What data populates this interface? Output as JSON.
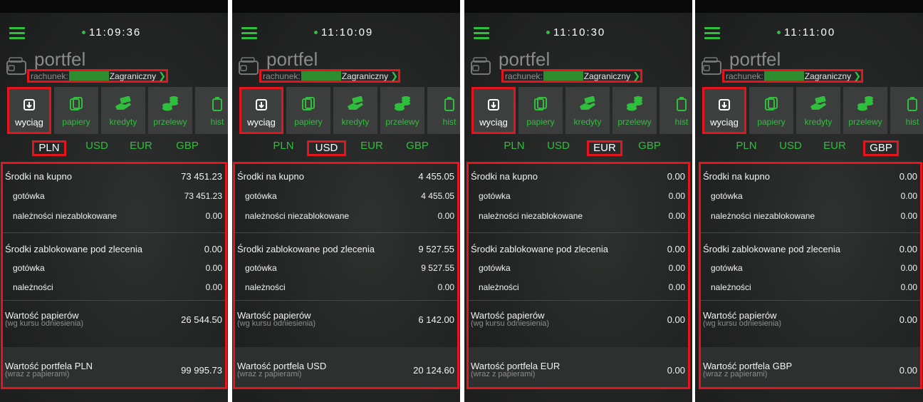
{
  "screens": [
    {
      "time": "11:09:36",
      "app_name": "portfel",
      "account_label": "rachunek:",
      "account_name": "Zagraniczny",
      "tiles": [
        "wyciąg",
        "papiery",
        "kredyty",
        "przelewy",
        "hist"
      ],
      "currencies": [
        "PLN",
        "USD",
        "EUR",
        "GBP"
      ],
      "active_currency": "PLN",
      "rows": {
        "buy_funds_label": "Środki na kupno",
        "buy_funds": "73 451.23",
        "cash_label": "gotówka",
        "cash": "73 451.23",
        "unblocked_label": "należności niezablokowane",
        "unblocked": "0.00",
        "blocked_label": "Środki zablokowane pod zlecenia",
        "blocked": "0.00",
        "blocked_cash_label": "gotówka",
        "blocked_cash": "0.00",
        "receivables_label": "należności",
        "receivables": "0.00",
        "securities_label": "Wartość papierów",
        "securities_note": "(wg kursu odniesienia)",
        "securities": "26 544.50",
        "portfolio_label": "Wartość portfela PLN",
        "portfolio_note": "(wraz z papierami)",
        "portfolio": "99 995.73"
      }
    },
    {
      "time": "11:10:09",
      "app_name": "portfel",
      "account_label": "rachunek:",
      "account_name": "Zagraniczny",
      "tiles": [
        "wyciąg",
        "papiery",
        "kredyty",
        "przelewy",
        "hist"
      ],
      "currencies": [
        "PLN",
        "USD",
        "EUR",
        "GBP"
      ],
      "active_currency": "USD",
      "rows": {
        "buy_funds_label": "Środki na kupno",
        "buy_funds": "4 455.05",
        "cash_label": "gotówka",
        "cash": "4 455.05",
        "unblocked_label": "należności niezablokowane",
        "unblocked": "0.00",
        "blocked_label": "Środki zablokowane pod zlecenia",
        "blocked": "9 527.55",
        "blocked_cash_label": "gotówka",
        "blocked_cash": "9 527.55",
        "receivables_label": "należności",
        "receivables": "0.00",
        "securities_label": "Wartość papierów",
        "securities_note": "(wg kursu odniesienia)",
        "securities": "6 142.00",
        "portfolio_label": "Wartość portfela USD",
        "portfolio_note": "(wraz z papierami)",
        "portfolio": "20 124.60"
      }
    },
    {
      "time": "11:10:30",
      "app_name": "portfel",
      "account_label": "rachunek:",
      "account_name": "Zagraniczny",
      "tiles": [
        "wyciąg",
        "papiery",
        "kredyty",
        "przelewy",
        "hist"
      ],
      "currencies": [
        "PLN",
        "USD",
        "EUR",
        "GBP"
      ],
      "active_currency": "EUR",
      "rows": {
        "buy_funds_label": "Środki na kupno",
        "buy_funds": "0.00",
        "cash_label": "gotówka",
        "cash": "0.00",
        "unblocked_label": "należności niezablokowane",
        "unblocked": "0.00",
        "blocked_label": "Środki zablokowane pod zlecenia",
        "blocked": "0.00",
        "blocked_cash_label": "gotówka",
        "blocked_cash": "0.00",
        "receivables_label": "należności",
        "receivables": "0.00",
        "securities_label": "Wartość papierów",
        "securities_note": "(wg kursu odniesienia)",
        "securities": "0.00",
        "portfolio_label": "Wartość portfela EUR",
        "portfolio_note": "(wraz z papierami)",
        "portfolio": "0.00"
      }
    },
    {
      "time": "11:11:00",
      "app_name": "portfel",
      "account_label": "rachunek:",
      "account_name": "Zagraniczny",
      "tiles": [
        "wyciąg",
        "papiery",
        "kredyty",
        "przelewy",
        "hist"
      ],
      "currencies": [
        "PLN",
        "USD",
        "EUR",
        "GBP"
      ],
      "active_currency": "GBP",
      "rows": {
        "buy_funds_label": "Środki na kupno",
        "buy_funds": "0.00",
        "cash_label": "gotówka",
        "cash": "0.00",
        "unblocked_label": "należności niezablokowane",
        "unblocked": "0.00",
        "blocked_label": "Środki zablokowane pod zlecenia",
        "blocked": "0.00",
        "blocked_cash_label": "gotówka",
        "blocked_cash": "0.00",
        "receivables_label": "należności",
        "receivables": "0.00",
        "securities_label": "Wartość papierów",
        "securities_note": "(wg kursu odniesienia)",
        "securities": "0.00",
        "portfolio_label": "Wartość portfela GBP",
        "portfolio_note": "(wraz z papierami)",
        "portfolio": "0.00"
      }
    }
  ],
  "colors": {
    "accent": "#2fbf3c",
    "highlight": "#e5151e",
    "panel_bg": "#232524",
    "tile_bg": "#3c3e3e"
  },
  "icons": [
    "menu-icon",
    "wallet-icon",
    "download-icon",
    "cards-icon",
    "money-hand-icon",
    "coins-icon",
    "history-icon",
    "chevron-right-icon"
  ]
}
